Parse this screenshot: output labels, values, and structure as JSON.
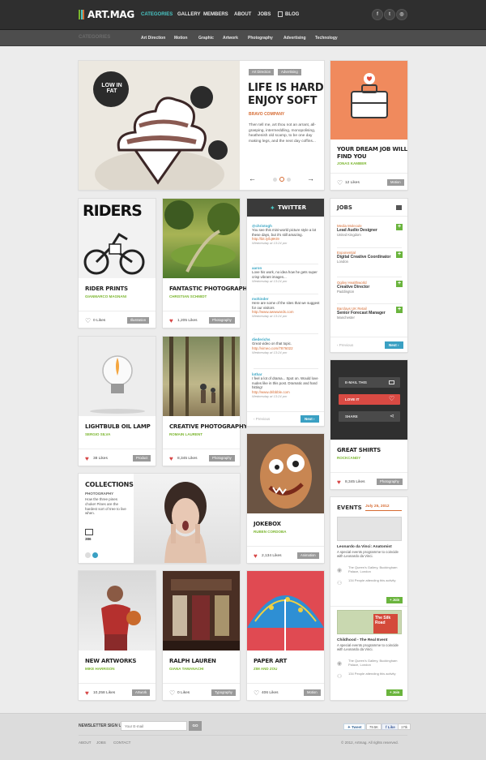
{
  "logo": {
    "text": "ART.MAG",
    "bar_colors": [
      "#7ab52d",
      "#49c6c4",
      "#d66b32"
    ]
  },
  "nav": {
    "items": [
      "CATEGORIES",
      "GALLERY",
      "MEMBERS",
      "ABOUT",
      "JOBS",
      "BLOG"
    ],
    "active": "CATEGORIES"
  },
  "social": [
    "f-icon",
    "twitter-icon",
    "dribbble-icon"
  ],
  "categories": {
    "label": "CATEGORIES",
    "items": [
      "Art Direction",
      "Motion",
      "Graphic",
      "Artwork",
      "Photography",
      "Advertising",
      "Technology"
    ]
  },
  "feature": {
    "tags": [
      "Art Direction",
      "Advertising"
    ],
    "title1": "LIFE IS HARD",
    "title2": "ENJOY SOFT",
    "company": "BRAVO COMPANY",
    "body": "Then tell me, art thou not an arrant, all-grasping, intermeddling, monopolising, heathenish old scamp, to be one day making legs, and the next day coffins...",
    "sign_text": "LOW IN FAT",
    "prev_arrow": "←",
    "next_arrow": "→"
  },
  "job_card": {
    "title1": "YOUR DREAM JOB WILL",
    "title2": "FIND YOU",
    "author": "JONAS KAMBER",
    "likes": "12 Likes",
    "tag": "Motion",
    "accent": "#f08a5d"
  },
  "cards": [
    {
      "id": "rider",
      "title": "RIDER PRINTS",
      "author": "GIANMARCO MAGNANI",
      "likes": "0 Likes",
      "tag": "Illustration",
      "liked": false,
      "art_text": "RIDERS"
    },
    {
      "id": "fantastic",
      "title": "FANTASTIC PHOTOGRAPHY",
      "author": "CHRISTIAN SCHMIDT",
      "likes": "1,205 Likes",
      "tag": "Photography",
      "liked": true
    },
    {
      "id": "bulb",
      "title": "LIGHTBULB OIL LAMP",
      "author": "SERGIO SILVA",
      "likes": "38 Likes",
      "tag": "Product",
      "liked": true
    },
    {
      "id": "creative",
      "title": "CREATIVE PHOTOGRAPHY",
      "author": "ROMAIN LAURENT",
      "likes": "8,345 Likes",
      "tag": "Photography",
      "liked": true
    },
    {
      "id": "jokebox",
      "title": "JOKEBOX",
      "author": "RUBEN CORDOBA",
      "likes": "2,134 Likes",
      "tag": "Animation",
      "liked": true
    },
    {
      "id": "shirts",
      "title": "GREAT SHIRTS",
      "author": "ROCKCANDY",
      "likes": "8,345 Likes",
      "tag": "Photography",
      "liked": true
    },
    {
      "id": "newart",
      "title": "NEW ARTWORKS",
      "author": "MIKE HARRISON",
      "likes": "10,258 Likes",
      "tag": "Artwork",
      "liked": true
    },
    {
      "id": "ralph",
      "title": "RALPH LAUREN",
      "author": "GIANA TAMANACHI",
      "likes": "0 Likes",
      "tag": "Typography",
      "liked": false
    },
    {
      "id": "paper",
      "title": "PAPER ART",
      "author": "ZIM AND ZOU",
      "likes": "406 Likes",
      "tag": "Motion",
      "liked": false
    }
  ],
  "collections": {
    "title": "COLLECTIONS",
    "category": "PHOTOGRAPHY",
    "body": "How the three pines choke! Pines are the hardest sort of tree to live when.",
    "count": "386"
  },
  "twitter": {
    "title": "TWITTER",
    "prev": "Previous",
    "next": "Next",
    "tweets": [
      {
        "handle": "@christogh",
        "text": "You see this mini-world picture style a lot these days, but it's still amazing.",
        "link": "http://bit.ly/lq9Kt9",
        "date": "Wednesday at 13:24 pm"
      },
      {
        "handle": "aaron",
        "text": "Love his work, no idea how he gets super crisp vibrant images...",
        "link": "",
        "date": "Wednesday at 13:24 pm"
      },
      {
        "handle": "mohinder",
        "text": "Here are some of the sites that we suggest for our visitors",
        "link": "http://www.awwwards.com",
        "date": "Wednesday at 13:24 pm"
      },
      {
        "handle": "diederichs",
        "text": "Great video on that topic.",
        "link": "http://vimeo.com/7876022",
        "date": "Wednesday at 13:24 pm"
      },
      {
        "handle": "lothar",
        "text": "I feel a lot of drama... Spot on. Would love nudes like in this post. Dramatic and hard hitting!",
        "link": "http://www.dribbble.com",
        "date": "Wednesday at 13:24 pm"
      }
    ]
  },
  "jobs": {
    "title": "JOBS",
    "prev": "Previous",
    "next": "Next",
    "items": [
      {
        "company": "Media Molecule",
        "role": "Lead Audio Designer",
        "location": "United Kingdom"
      },
      {
        "company": "Exponential",
        "role": "Digital Creative Coordinator",
        "location": "London"
      },
      {
        "company": "Ogilvy Healthworld",
        "role": "Creative Director",
        "location": "Paddington"
      },
      {
        "company": "Barclays UK Retail",
        "role": "Senior Forecast Manager",
        "location": "Manchester"
      }
    ]
  },
  "share": {
    "email": "E-MAIL THIS",
    "love": "LOVE IT",
    "share": "SHARE"
  },
  "events": {
    "title": "EVENTS",
    "date": "July 25, 2012",
    "items": [
      {
        "title": "Leonardo da Vinci: Anatomist",
        "body": "A special events programme to coincide with Leonardo da Vinci.",
        "venue": "The Queen's Gallery, Buckingham Palace, London",
        "attending": "134 People attending this activity",
        "join": "+ Join"
      },
      {
        "title": "Childhood - The Real Event",
        "body": "A special events programme to coincide with Leonardo da Vinci.",
        "venue": "The Queen's Gallery, Buckingham Palace, London",
        "attending": "134 People attending this activity",
        "join": "+ Join",
        "sign_text": "The Silk Road"
      }
    ]
  },
  "footer": {
    "newsletter": "NEWSLETTER SIGN UP",
    "email_placeholder": "Your E-mail",
    "go": "GO",
    "tweet": "Tweet",
    "tweet_count": "79.5K",
    "like": "Like",
    "like_count": "17tk",
    "links": [
      "ABOUT",
      "JOBS",
      "CONTACT"
    ],
    "copyright": "© 2012, Artmag. All rights reserved."
  }
}
